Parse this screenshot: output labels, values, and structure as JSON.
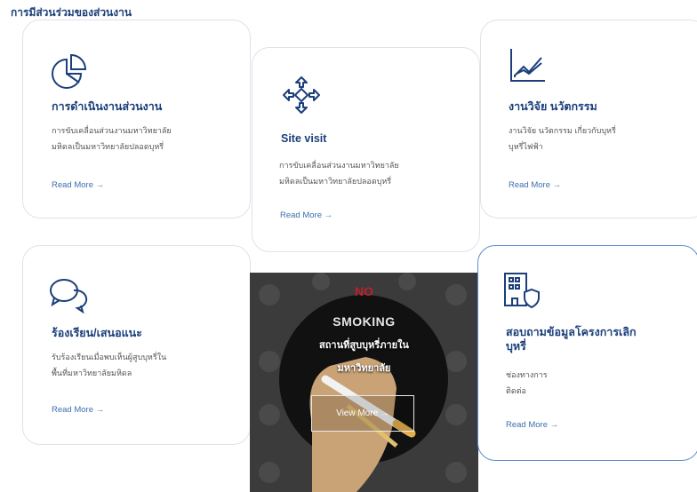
{
  "section_title": "การมีส่วนร่วมของส่วนงาน",
  "cards": [
    {
      "icon": "pie-chart-icon",
      "title": "การดำเนินงานส่วนงาน",
      "desc_lines": [
        "การขับเคลื่อนส่วนงานมหาวิทยาลัย",
        "มหิดลเป็นมหาวิทยาลัยปลอดบุหรี่"
      ],
      "link": "Read More →"
    },
    {
      "icon": "compass-arrows-icon",
      "title": "Site visit",
      "desc_lines": [
        "การขับเคลื่อนส่วนงานมหาวิทยาลัย",
        "มหิดลเป็นมหาวิทยาลัยปลอดบุหรี่"
      ],
      "link": "Read More →"
    },
    {
      "icon": "line-chart-icon",
      "title": "งานวิจัย นวัตกรรม",
      "desc_lines": [
        "งานวิจัย นวัตกรรม เกี่ยวกับบุหรี่",
        "บุหรี่ไฟฟ้า"
      ],
      "link": "Read More →"
    },
    {
      "icon": "chat-bubbles-icon",
      "title": "ร้องเรียน/เสนอแนะ",
      "desc_lines": [
        "รับร้องเรียนเมื่อพบเห็นผู้สูบบุหรี่ใน",
        "พื้นที่มหาวิทยาลัยมหิดล"
      ],
      "link": "Read More →"
    },
    {
      "icon": "building-shield-icon",
      "title_lines": [
        "สอบถามข้อมูลโครงการเลิก",
        "บุหรี่"
      ],
      "desc_lines": [
        "ช่องทางการ",
        "ติดต่อ"
      ],
      "link": "Read More →"
    }
  ],
  "promo": {
    "no_text": "NO",
    "smoking_text": "SMOKING",
    "line1": "สถานที่สูบบุหรี่ภายใน",
    "line2": "มหาวิทยาลัย",
    "button": "View More →"
  },
  "colors": {
    "title": "#1b3f7a",
    "link": "#3e6fb0",
    "active_border": "#5a8fd0",
    "promo_red": "#c0202a"
  }
}
